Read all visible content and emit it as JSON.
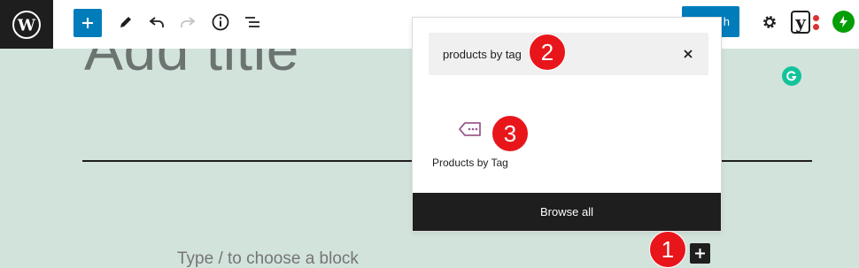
{
  "toolbar": {
    "publish_label": "Publish",
    "publish_visible_fragment": "h",
    "yoast_letter": "y",
    "icons": [
      "wordpress-icon",
      "plus-icon",
      "pencil-icon",
      "undo-icon",
      "redo-icon",
      "info-icon",
      "list-view-icon",
      "gear-icon",
      "yoast-icon",
      "jetpack-icon"
    ]
  },
  "editor": {
    "title_placeholder": "Add title",
    "block_placeholder": "Type / to choose a block"
  },
  "inserter": {
    "search_value": "products by tag",
    "result_label": "Products by Tag",
    "browse_all_label": "Browse all"
  },
  "markers": {
    "one": "1",
    "two": "2",
    "three": "3"
  },
  "colors": {
    "accent": "#007cba",
    "canvas": "#d2e3dc",
    "dark": "#1e1e1e",
    "marker": "#e8161b",
    "block_icon": "#9b5c8f"
  }
}
